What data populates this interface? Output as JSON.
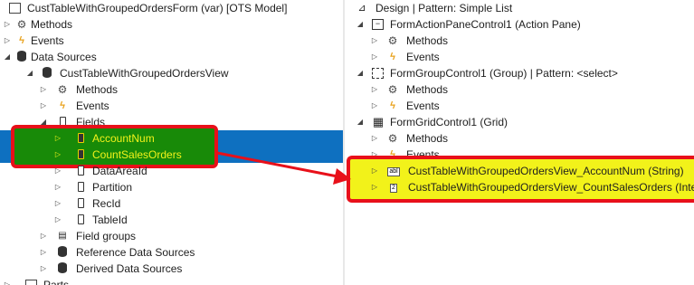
{
  "left_tree": {
    "root": "CustTableWithGroupedOrdersForm (var) [OTS Model]",
    "methods": "Methods",
    "events": "Events",
    "data_sources": "Data Sources",
    "view": "CustTableWithGroupedOrdersView",
    "view_methods": "Methods",
    "view_events": "Events",
    "fields": "Fields",
    "field_items": [
      "AccountNum",
      "CountSalesOrders",
      "DataAreaId",
      "Partition",
      "RecId",
      "TableId"
    ],
    "field_groups": "Field groups",
    "reference_data_sources": "Reference Data Sources",
    "derived_data_sources": "Derived Data Sources",
    "parts": "Parts"
  },
  "right_tree": {
    "design": "Design | Pattern: Simple List",
    "action_pane": "FormActionPaneControl1 (Action Pane)",
    "action_pane_methods": "Methods",
    "action_pane_events": "Events",
    "group": "FormGroupControl1 (Group) | Pattern: <select>",
    "group_methods": "Methods",
    "group_events": "Events",
    "grid": "FormGridControl1 (Grid)",
    "grid_methods": "Methods",
    "grid_events": "Events",
    "grid_fields": [
      {
        "tag": "abl",
        "label": "CustTableWithGroupedOrdersView_AccountNum (String)"
      },
      {
        "tag": "2",
        "label": "CustTableWithGroupedOrdersView_CountSalesOrders (Integ"
      }
    ]
  },
  "colors": {
    "selection": "#0e70c0",
    "highlight_green": "#188a08",
    "highlight_yellow": "#f2f21a",
    "callout_red": "#e8101a"
  }
}
